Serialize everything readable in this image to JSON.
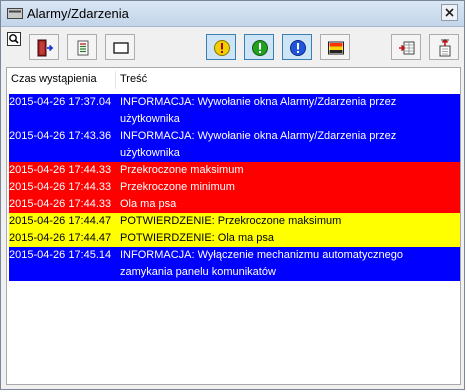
{
  "window": {
    "title": "Alarmy/Zdarzenia",
    "close_glyph": "×"
  },
  "toolbar": {
    "buttons": [
      {
        "name": "exit-button",
        "icon": "exit-door-icon"
      },
      {
        "name": "list-button",
        "icon": "list-icon"
      },
      {
        "name": "window-button",
        "icon": "window-icon"
      },
      {
        "name": "filter-warning-button",
        "icon": "warning-icon",
        "color": "#f0d000"
      },
      {
        "name": "filter-ok-button",
        "icon": "ok-icon",
        "color": "#22a022"
      },
      {
        "name": "filter-info-button",
        "icon": "info-icon",
        "color": "#2255dd"
      },
      {
        "name": "colors-button",
        "icon": "color-bars-icon"
      },
      {
        "name": "columns-button",
        "icon": "columns-icon"
      },
      {
        "name": "export-button",
        "icon": "export-icon"
      }
    ]
  },
  "columns": {
    "time": "Czas wystąpienia",
    "content": "Treść"
  },
  "rows": [
    {
      "time": "2015-04-26 17:37.04",
      "msg": "INFORMACJA: Wywołanie okna Alarmy/Zdarzenia przez użytkownika",
      "color": "blue"
    },
    {
      "time": "2015-04-26 17:43.36",
      "msg": "INFORMACJA: Wywołanie okna Alarmy/Zdarzenia przez użytkownika",
      "color": "blue"
    },
    {
      "time": "2015-04-26 17:44.33",
      "msg": "Przekroczone maksimum",
      "color": "red"
    },
    {
      "time": "2015-04-26 17:44.33",
      "msg": "Przekroczone minimum",
      "color": "red"
    },
    {
      "time": "2015-04-26 17:44.33",
      "msg": "Ola ma psa",
      "color": "red"
    },
    {
      "time": "2015-04-26 17:44.47",
      "msg": "POTWIERDZENIE: Przekroczone maksimum",
      "color": "yellow"
    },
    {
      "time": "2015-04-26 17:44.47",
      "msg": "POTWIERDZENIE: Ola ma psa",
      "color": "yellow"
    },
    {
      "time": "2015-04-26 17:45.14",
      "msg": "INFORMACJA: Wyłączenie mechanizmu automatycznego zamykania panelu komunikatów",
      "color": "blue"
    }
  ],
  "colors": {
    "blue": "#0000ff",
    "red": "#ff0000",
    "yellow": "#ffff00"
  }
}
